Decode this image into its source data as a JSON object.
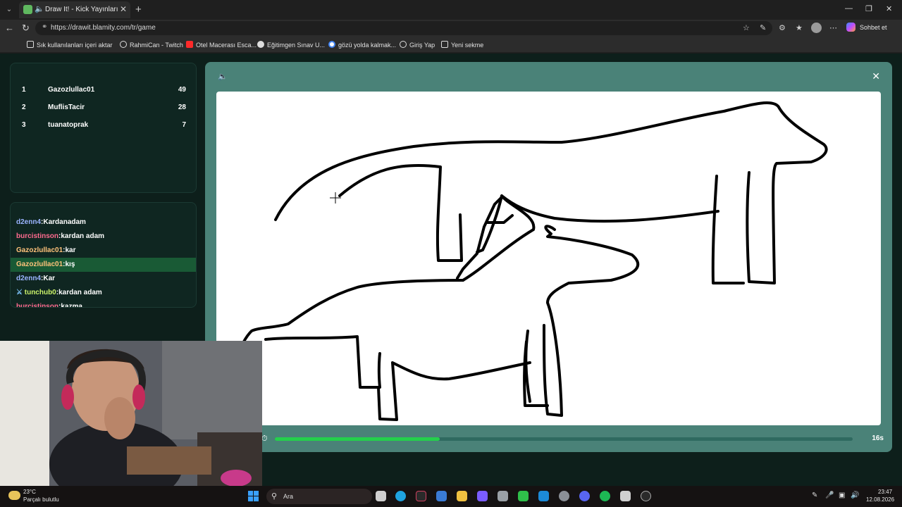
{
  "browser": {
    "tab_title": "Draw It! - Kick Yayınları İçin Ç",
    "url": "https://drawit.blamity.com/tr/game",
    "copilot_label": "Sohbet et",
    "bookmarks": [
      {
        "label": "Sık kullanılanları içeri aktar",
        "icon": "folder-icon"
      },
      {
        "label": "RahmiCan - Twitch",
        "icon": "globe-icon"
      },
      {
        "label": "Otel Macerası Esca...",
        "icon": "youtube-icon"
      },
      {
        "label": "Eğitimgen Sınav U...",
        "icon": "site-icon"
      },
      {
        "label": "gözü yolda kalmak...",
        "icon": "google-icon"
      },
      {
        "label": "Giriş Yap",
        "icon": "globe-icon"
      },
      {
        "label": "Yeni sekme",
        "icon": "page-icon"
      }
    ]
  },
  "leaderboard": [
    {
      "rank": "1",
      "name": "Gazozlullac01",
      "score": "49"
    },
    {
      "rank": "2",
      "name": "MuflisTacir",
      "score": "28"
    },
    {
      "rank": "3",
      "name": "tuanatoprak",
      "score": "7"
    }
  ],
  "chat": [
    {
      "user": "d2enn4",
      "text": "Kardanadam",
      "color": "#9bb4ff",
      "highlight": false
    },
    {
      "user": "burcistinson",
      "text": "kardan adam",
      "color": "#ff6b8f",
      "highlight": false
    },
    {
      "user": "Gazozlullac01",
      "text": "kar",
      "color": "#ffc27a",
      "highlight": false
    },
    {
      "user": "Gazozlullac01",
      "text": "kış",
      "color": "#ffc27a",
      "highlight": true
    },
    {
      "user": "d2enn4",
      "text": "Kar",
      "color": "#9bb4ff",
      "highlight": false
    },
    {
      "user": "tunchub0",
      "text": "kardan adam",
      "color": "#c9f06a",
      "highlight": false,
      "badge": "sword-icon"
    },
    {
      "user": "burcistinson",
      "text": "kazma",
      "color": "#ff6b8f",
      "highlight": false
    }
  ],
  "game": {
    "timer_text": "16s",
    "progress_fraction": 0.285
  },
  "taskbar": {
    "weather_temp": "23°C",
    "weather_desc": "Parçalı bulutlu",
    "search_text": "Ara",
    "time": "23:47",
    "date": "12.08.2026"
  },
  "colors": {
    "page_bg": "#0d1f1b",
    "panel_bg": "#0f2621",
    "game_panel": "#4a8278",
    "accent_green": "#24d04c",
    "chat_highlight": "#195a35"
  }
}
